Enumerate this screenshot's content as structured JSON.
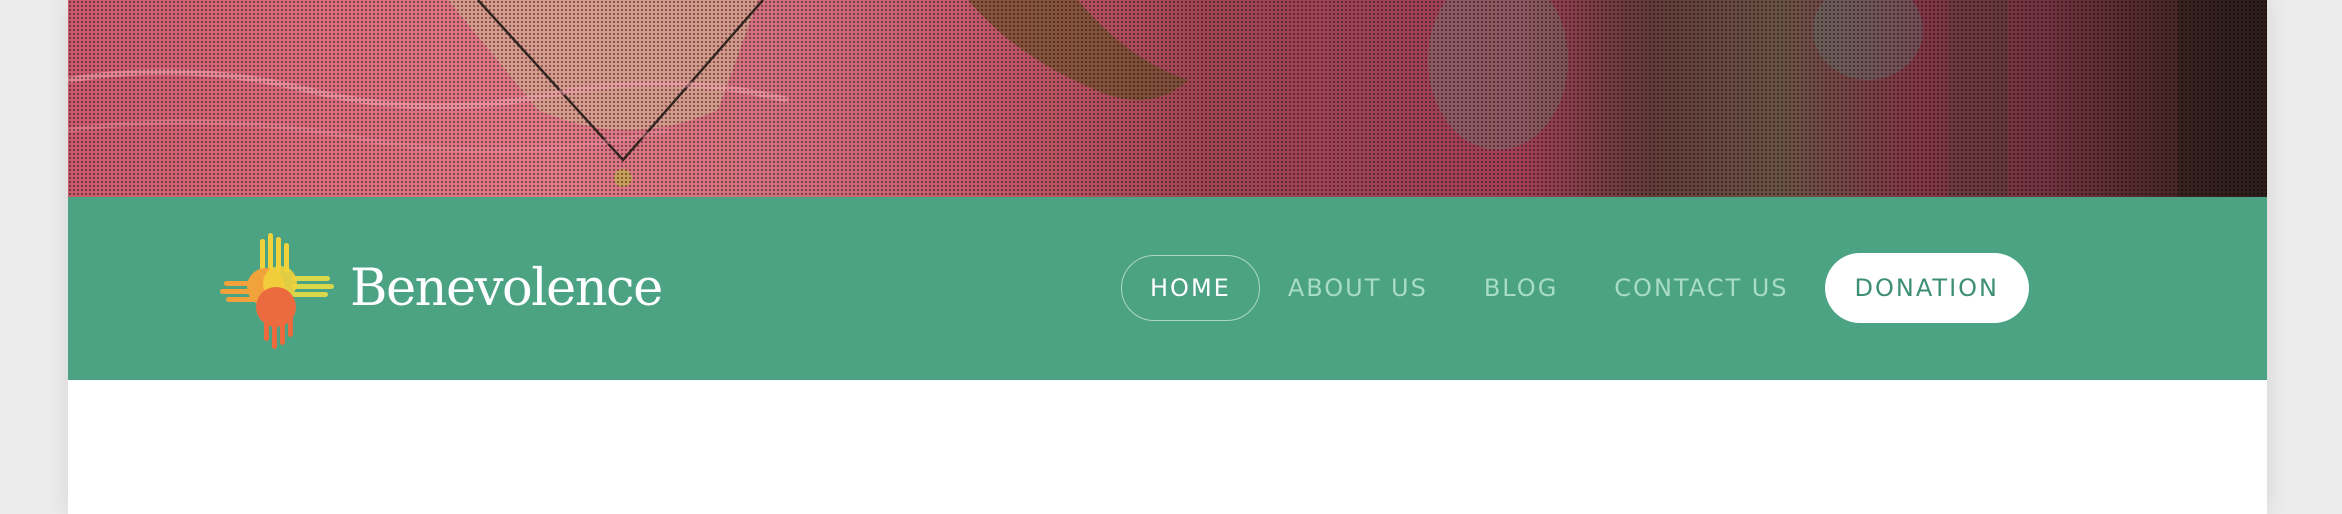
{
  "hero": {
    "image_alt_icon": "hero-photo"
  },
  "brand": {
    "name": "Benevolence",
    "logo_icon": "zia-sun-hands-logo-icon",
    "colors": {
      "green": "#4ba383",
      "yellow": "#f2d23c",
      "orange": "#f1a23a",
      "red_orange": "#ec6b3e"
    }
  },
  "nav": {
    "items": [
      {
        "label": "HOME",
        "active": true
      },
      {
        "label": "ABOUT US",
        "active": false
      },
      {
        "label": "BLOG",
        "active": false
      },
      {
        "label": "CONTACT US",
        "active": false
      }
    ],
    "cta_label": "DONATION"
  }
}
